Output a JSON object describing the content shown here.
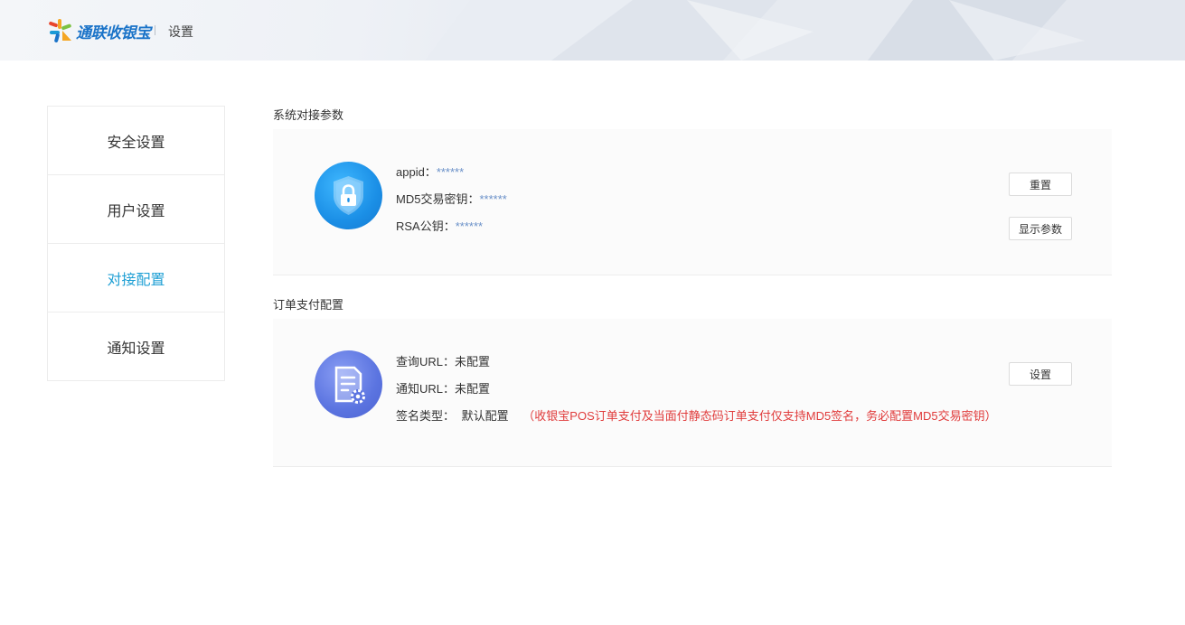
{
  "header": {
    "logo_text": "通联收银宝",
    "title": "设置"
  },
  "sidebar": {
    "items": [
      {
        "label": "安全设置"
      },
      {
        "label": "用户设置"
      },
      {
        "label": "对接配置"
      },
      {
        "label": "通知设置"
      }
    ],
    "active_color": "#1e9fd4"
  },
  "sections": {
    "system": {
      "title": "系统对接参数",
      "appid_label": "appid：",
      "appid_value": "******",
      "md5_label": "MD5交易密钥：",
      "md5_value": "******",
      "rsa_label": "RSA公钥：",
      "rsa_value": "******",
      "reset_button": "重置",
      "show_params_button": "显示参数",
      "icon": "lock-shield-icon"
    },
    "order": {
      "title": "订单支付配置",
      "query_label": "查询URL：",
      "query_value": "未配置",
      "notify_label": "通知URL：",
      "notify_value": "未配置",
      "sign_label": "签名类型：",
      "sign_value": "默认配置",
      "sign_note": "（收银宝POS订单支付及当面付静态码订单支付仅支持MD5签名，务必配置MD5交易密钥）",
      "settings_button": "设置",
      "icon": "document-gear-icon"
    }
  },
  "colors": {
    "accent": "#1e9fd4",
    "warning": "#e03b3b",
    "masked_value": "#6a90c8"
  }
}
